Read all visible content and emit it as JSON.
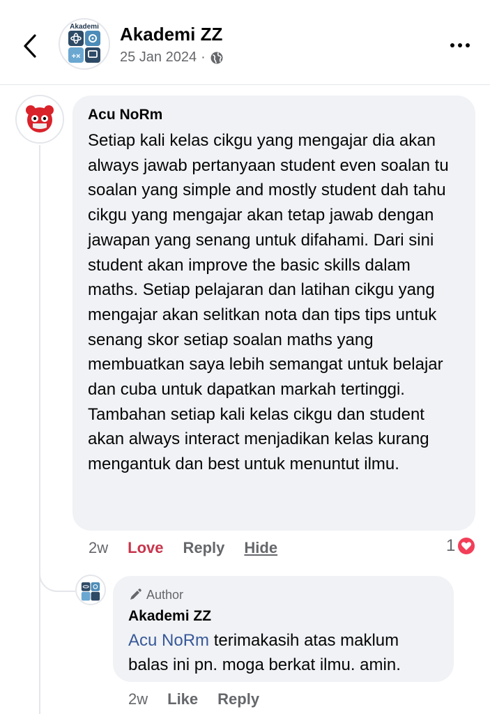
{
  "post": {
    "page_name": "Akademi ZZ",
    "date": "25 Jan 2024",
    "separator": "·",
    "privacy_icon": "globe-icon",
    "logo_text": "Akademi"
  },
  "comment": {
    "author": "Acu NoRm",
    "text": "Setiap kali kelas cikgu yang mengajar dia akan always jawab pertanyaan student even soalan tu soalan yang simple and mostly student dah tahu cikgu yang mengajar akan tetap jawab dengan jawapan yang senang untuk difahami. Dari sini student akan improve the basic skills dalam maths. Setiap pelajaran dan latihan cikgu yang mengajar akan selitkan nota dan tips tips untuk senang skor setiap soalan maths yang membuatkan saya lebih semangat untuk belajar dan cuba untuk dapatkan markah tertinggi. Tambahan setiap kali kelas cikgu dan student akan always interact menjadikan kelas kurang mengantuk dan best untuk menuntut ilmu.",
    "time": "2w",
    "love_label": "Love",
    "reply_label": "Reply",
    "hide_label": "Hide",
    "reaction_count": "1"
  },
  "reply": {
    "badge": "Author",
    "author": "Akademi ZZ",
    "mention": "Acu NoRm",
    "text": " terimakasih atas maklum balas ini pn. moga berkat ilmu. amin.",
    "time": "2w",
    "like_label": "Like",
    "reply_label": "Reply"
  },
  "colors": {
    "love": "#c8354c",
    "heart": "#f33e58",
    "mention": "#385898",
    "bubble": "#f0f2f5",
    "muted": "#65676b"
  }
}
